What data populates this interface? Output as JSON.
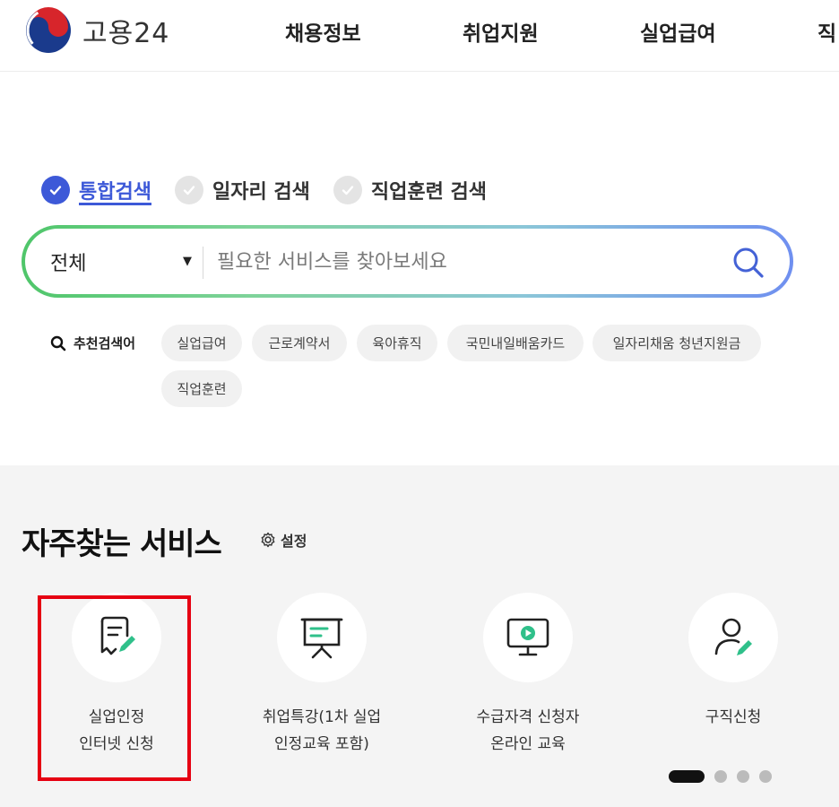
{
  "header": {
    "logo_text": "고용24",
    "nav": [
      "채용정보",
      "취업지원",
      "실업급여",
      "직"
    ]
  },
  "search": {
    "tabs": [
      {
        "label": "통합검색",
        "selected": true
      },
      {
        "label": "일자리 검색",
        "selected": false
      },
      {
        "label": "직업훈련 검색",
        "selected": false
      }
    ],
    "scope": "전체",
    "placeholder": "필요한 서비스를 찾아보세요",
    "value": ""
  },
  "recommended": {
    "title": "추천검색어",
    "keywords": [
      "실업급여",
      "근로계약서",
      "육아휴직",
      "국민내일배움카드",
      "일자리채움 청년지원금",
      "직업훈련"
    ]
  },
  "frequent": {
    "title": "자주찾는 서비스",
    "setting_label": "설정",
    "services": [
      {
        "icon": "document-edit-icon",
        "line1": "실업인정",
        "line2": "인터넷 신청",
        "highlighted": true
      },
      {
        "icon": "presentation-board-icon",
        "line1": "취업특강(1차 실업",
        "line2": "인정교육 포함)",
        "highlighted": false
      },
      {
        "icon": "monitor-play-icon",
        "line1": "수급자격 신청자",
        "line2": "온라인 교육",
        "highlighted": false
      },
      {
        "icon": "user-edit-icon",
        "line1": "구직신청",
        "line2": "",
        "highlighted": false
      }
    ],
    "pager": {
      "total": 4,
      "current": 1
    }
  },
  "colors": {
    "accent_blue": "#3d59d8",
    "icon_green": "#2fc08a",
    "highlight_red": "#e60012",
    "section_bg": "#f4f4f4"
  }
}
